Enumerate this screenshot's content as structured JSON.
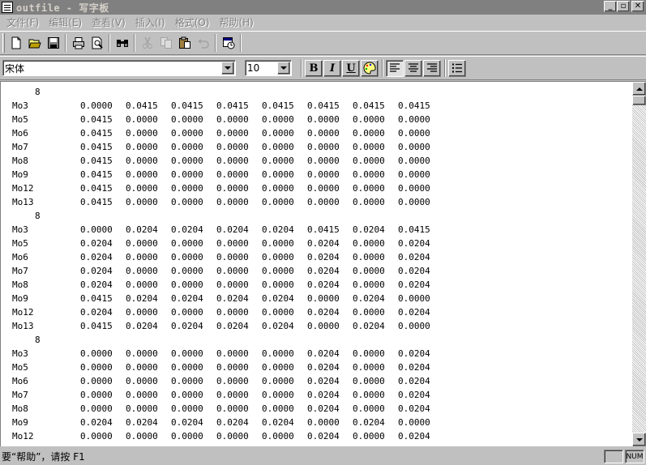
{
  "window": {
    "title": "outfile - 写字板",
    "min_label": "_",
    "max_label": "▫",
    "close_label": "✕"
  },
  "menu": [
    {
      "label": "文件(F)"
    },
    {
      "label": "编辑(E)"
    },
    {
      "label": "查看(V)"
    },
    {
      "label": "插入(I)"
    },
    {
      "label": "格式(O)"
    },
    {
      "label": "帮助(H)"
    }
  ],
  "toolbar": {
    "icons": [
      "new-icon",
      "open-icon",
      "save-icon",
      "print-icon",
      "print-preview-icon",
      "find-icon",
      "cut-icon",
      "copy-icon",
      "paste-icon",
      "undo-icon",
      "insert-datetime-icon"
    ]
  },
  "format_bar": {
    "font_name": "宋体",
    "font_size": "10",
    "bold_label": "B",
    "italic_label": "I",
    "underline_label": "U"
  },
  "document": {
    "blocks": [
      {
        "count": "8",
        "rows": [
          {
            "label": "Mo3",
            "values": [
              "0.0000",
              "0.0415",
              "0.0415",
              "0.0415",
              "0.0415",
              "0.0415",
              "0.0415",
              "0.0415"
            ]
          },
          {
            "label": "Mo5",
            "values": [
              "0.0415",
              "0.0000",
              "0.0000",
              "0.0000",
              "0.0000",
              "0.0000",
              "0.0000",
              "0.0000"
            ]
          },
          {
            "label": "Mo6",
            "values": [
              "0.0415",
              "0.0000",
              "0.0000",
              "0.0000",
              "0.0000",
              "0.0000",
              "0.0000",
              "0.0000"
            ]
          },
          {
            "label": "Mo7",
            "values": [
              "0.0415",
              "0.0000",
              "0.0000",
              "0.0000",
              "0.0000",
              "0.0000",
              "0.0000",
              "0.0000"
            ]
          },
          {
            "label": "Mo8",
            "values": [
              "0.0415",
              "0.0000",
              "0.0000",
              "0.0000",
              "0.0000",
              "0.0000",
              "0.0000",
              "0.0000"
            ]
          },
          {
            "label": "Mo9",
            "values": [
              "0.0415",
              "0.0000",
              "0.0000",
              "0.0000",
              "0.0000",
              "0.0000",
              "0.0000",
              "0.0000"
            ]
          },
          {
            "label": "Mo12",
            "values": [
              "0.0415",
              "0.0000",
              "0.0000",
              "0.0000",
              "0.0000",
              "0.0000",
              "0.0000",
              "0.0000"
            ]
          },
          {
            "label": "Mo13",
            "values": [
              "0.0415",
              "0.0000",
              "0.0000",
              "0.0000",
              "0.0000",
              "0.0000",
              "0.0000",
              "0.0000"
            ]
          }
        ]
      },
      {
        "count": "8",
        "rows": [
          {
            "label": "Mo3",
            "values": [
              "0.0000",
              "0.0204",
              "0.0204",
              "0.0204",
              "0.0204",
              "0.0415",
              "0.0204",
              "0.0415"
            ]
          },
          {
            "label": "Mo5",
            "values": [
              "0.0204",
              "0.0000",
              "0.0000",
              "0.0000",
              "0.0000",
              "0.0204",
              "0.0000",
              "0.0204"
            ]
          },
          {
            "label": "Mo6",
            "values": [
              "0.0204",
              "0.0000",
              "0.0000",
              "0.0000",
              "0.0000",
              "0.0204",
              "0.0000",
              "0.0204"
            ]
          },
          {
            "label": "Mo7",
            "values": [
              "0.0204",
              "0.0000",
              "0.0000",
              "0.0000",
              "0.0000",
              "0.0204",
              "0.0000",
              "0.0204"
            ]
          },
          {
            "label": "Mo8",
            "values": [
              "0.0204",
              "0.0000",
              "0.0000",
              "0.0000",
              "0.0000",
              "0.0204",
              "0.0000",
              "0.0204"
            ]
          },
          {
            "label": "Mo9",
            "values": [
              "0.0415",
              "0.0204",
              "0.0204",
              "0.0204",
              "0.0204",
              "0.0000",
              "0.0204",
              "0.0000"
            ]
          },
          {
            "label": "Mo12",
            "values": [
              "0.0204",
              "0.0000",
              "0.0000",
              "0.0000",
              "0.0000",
              "0.0204",
              "0.0000",
              "0.0204"
            ]
          },
          {
            "label": "Mo13",
            "values": [
              "0.0415",
              "0.0204",
              "0.0204",
              "0.0204",
              "0.0204",
              "0.0000",
              "0.0204",
              "0.0000"
            ]
          }
        ]
      },
      {
        "count": "8",
        "rows": [
          {
            "label": "Mo3",
            "values": [
              "0.0000",
              "0.0000",
              "0.0000",
              "0.0000",
              "0.0000",
              "0.0204",
              "0.0000",
              "0.0204"
            ]
          },
          {
            "label": "Mo5",
            "values": [
              "0.0000",
              "0.0000",
              "0.0000",
              "0.0000",
              "0.0000",
              "0.0204",
              "0.0000",
              "0.0204"
            ]
          },
          {
            "label": "Mo6",
            "values": [
              "0.0000",
              "0.0000",
              "0.0000",
              "0.0000",
              "0.0000",
              "0.0204",
              "0.0000",
              "0.0204"
            ]
          },
          {
            "label": "Mo7",
            "values": [
              "0.0000",
              "0.0000",
              "0.0000",
              "0.0000",
              "0.0000",
              "0.0204",
              "0.0000",
              "0.0204"
            ]
          },
          {
            "label": "Mo8",
            "values": [
              "0.0000",
              "0.0000",
              "0.0000",
              "0.0000",
              "0.0000",
              "0.0204",
              "0.0000",
              "0.0204"
            ]
          },
          {
            "label": "Mo9",
            "values": [
              "0.0204",
              "0.0204",
              "0.0204",
              "0.0204",
              "0.0204",
              "0.0000",
              "0.0204",
              "0.0000"
            ]
          },
          {
            "label": "Mo12",
            "values": [
              "0.0000",
              "0.0000",
              "0.0000",
              "0.0000",
              "0.0000",
              "0.0204",
              "0.0000",
              "0.0204"
            ]
          }
        ]
      }
    ]
  },
  "statusbar": {
    "help_text": "要“帮助”，请按 F1",
    "num_label": "NUM"
  }
}
